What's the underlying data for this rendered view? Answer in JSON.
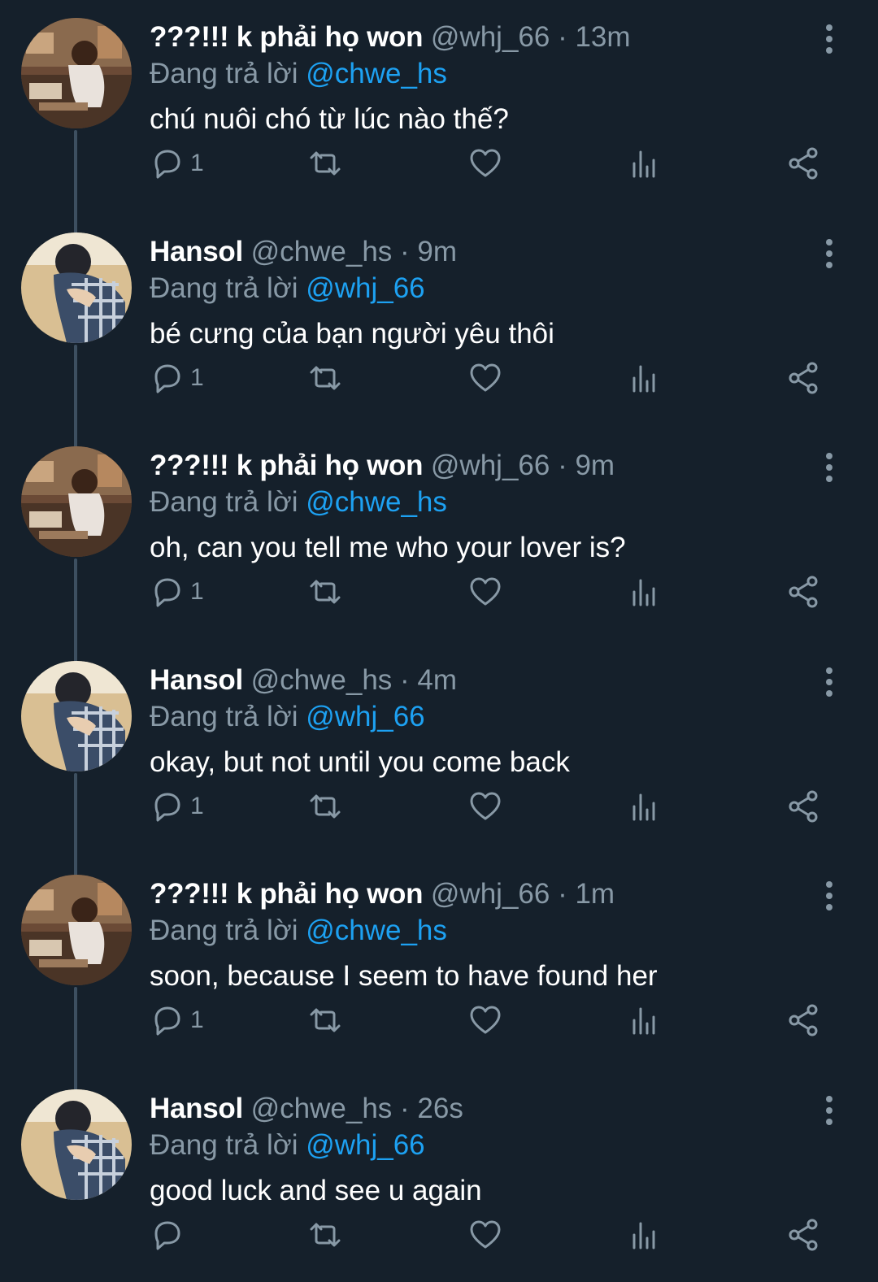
{
  "tweets": [
    {
      "author": "???!!! k phải họ won",
      "handle": "@whj_66",
      "dot": "·",
      "time": "13m",
      "reply_prefix": "Đang trả lời",
      "reply_to": "@chwe_hs",
      "text": "chú nuôi chó từ lúc nào thế?",
      "reply_count": "1",
      "avatar": "girl-avatar"
    },
    {
      "author": "Hansol",
      "handle": "@chwe_hs",
      "dot": "·",
      "time": "9m",
      "reply_prefix": "Đang trả lời",
      "reply_to": "@whj_66",
      "text": "bé cưng của bạn người yêu thôi",
      "reply_count": "1",
      "avatar": "boy-avatar"
    },
    {
      "author": "???!!! k phải họ won",
      "handle": "@whj_66",
      "dot": "·",
      "time": "9m",
      "reply_prefix": "Đang trả lời",
      "reply_to": "@chwe_hs",
      "text": "oh, can you tell me who your lover is?",
      "reply_count": "1",
      "avatar": "girl-avatar"
    },
    {
      "author": "Hansol",
      "handle": "@chwe_hs",
      "dot": "·",
      "time": "4m",
      "reply_prefix": "Đang trả lời",
      "reply_to": "@whj_66",
      "text": "okay, but not until you come back",
      "reply_count": "1",
      "avatar": "boy-avatar"
    },
    {
      "author": "???!!! k phải họ won",
      "handle": "@whj_66",
      "dot": "·",
      "time": "1m",
      "reply_prefix": "Đang trả lời",
      "reply_to": "@chwe_hs",
      "text": "soon, because I seem to have found her",
      "reply_count": "1",
      "avatar": "girl-avatar"
    },
    {
      "author": "Hansol",
      "handle": "@chwe_hs",
      "dot": "·",
      "time": "26s",
      "reply_prefix": "Đang trả lời",
      "reply_to": "@whj_66",
      "text": "good luck and see u again",
      "reply_count": "",
      "avatar": "boy-avatar"
    }
  ],
  "colors": {
    "background": "#15202b",
    "muted": "#8899a6",
    "link": "#1da1f2",
    "thread_line": "#3d4f60"
  },
  "icons": [
    "reply-icon",
    "retweet-icon",
    "like-icon",
    "stats-icon",
    "share-icon",
    "more-icon"
  ]
}
